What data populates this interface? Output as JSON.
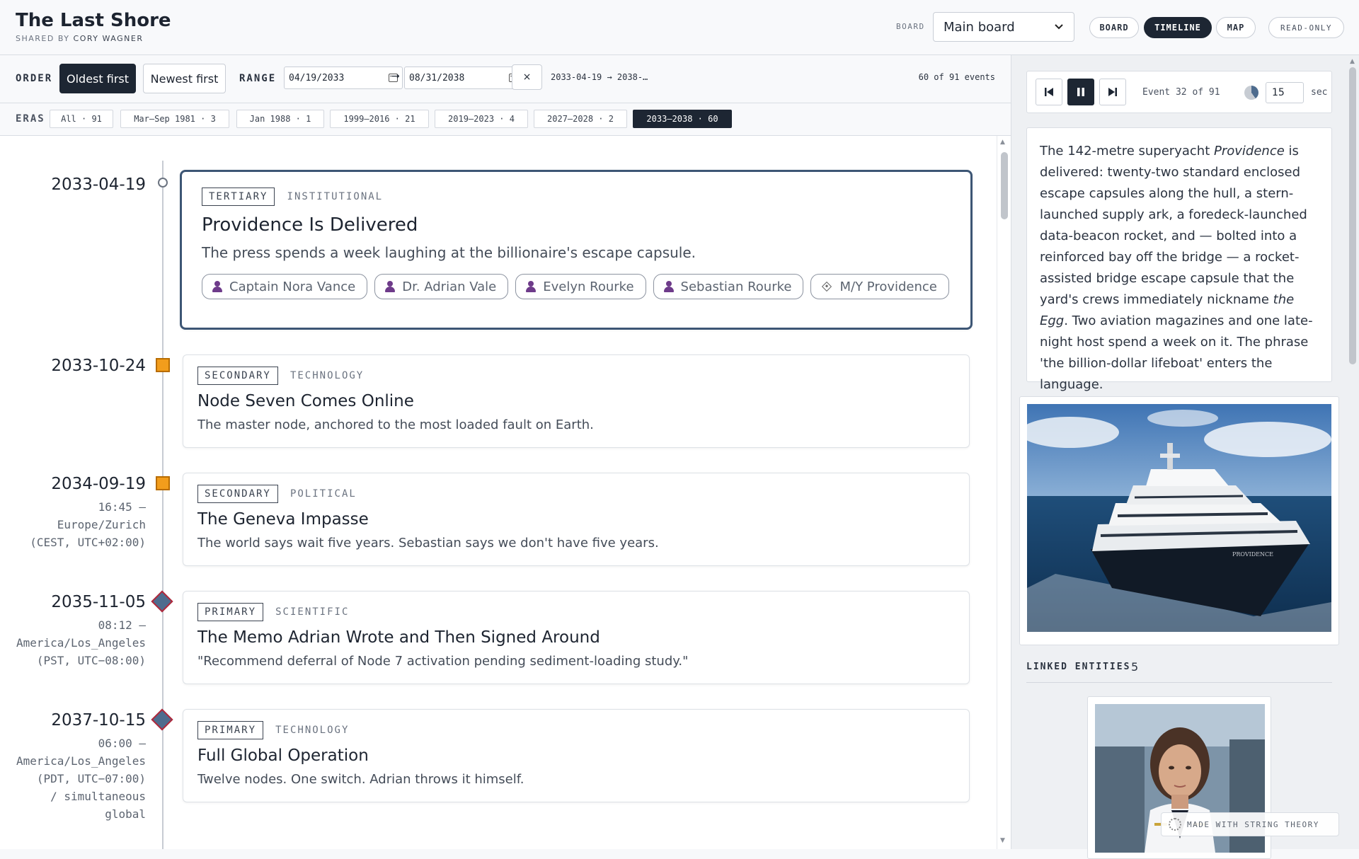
{
  "header": {
    "title": "The Last Shore",
    "shared_by_prefix": "SHARED BY",
    "shared_by_name": "CORY WAGNER",
    "board_label": "BOARD",
    "board_value": "Main board",
    "views": [
      "BOARD",
      "TIMELINE",
      "MAP"
    ],
    "active_view": "TIMELINE",
    "read_only": "READ-ONLY"
  },
  "toolbar": {
    "order_label": "ORDER",
    "oldest_first": "Oldest first",
    "newest_first": "Newest first",
    "range_label": "RANGE",
    "range_start": "04/19/2033",
    "range_end": "08/31/2038",
    "arrow": "→",
    "clear": "×",
    "range_summary": "2033-04-19 → 2038-…",
    "event_count": "60 of 91 events"
  },
  "eras": {
    "label": "ERAS",
    "items": [
      "All · 91",
      "Mar–Sep 1981 · 3",
      "Jan 1988 · 1",
      "1999–2016 · 21",
      "2019–2023 · 4",
      "2027–2028 · 2",
      "2033–2038 · 60"
    ],
    "active_index": 6
  },
  "events": [
    {
      "date": "2033-04-19",
      "time": "",
      "tier": "TERTIARY",
      "category": "INSTITUTIONAL",
      "title": "Providence Is Delivered",
      "desc": "The press spends a week laughing at the billionaire's escape capsule.",
      "chips": [
        "Captain Nora Vance",
        "Dr. Adrian Vale",
        "Evelyn Rourke",
        "Sebastian Rourke",
        "M/Y Providence"
      ]
    },
    {
      "date": "2033-10-24",
      "time": "",
      "tier": "SECONDARY",
      "category": "TECHNOLOGY",
      "title": "Node Seven Comes Online",
      "desc": "The master node, anchored to the most loaded fault on Earth."
    },
    {
      "date": "2034-09-19",
      "time_lines": [
        "16:45 —",
        "Europe/Zurich",
        "(CEST, UTC+02:00)"
      ],
      "tier": "SECONDARY",
      "category": "POLITICAL",
      "title": "The Geneva Impasse",
      "desc": "The world says wait five years. Sebastian says we don't have five years."
    },
    {
      "date": "2035-11-05",
      "time_lines": [
        "08:12 —",
        "America/Los_Angeles",
        "(PST, UTC−08:00)"
      ],
      "tier": "PRIMARY",
      "category": "SCIENTIFIC",
      "title": "The Memo Adrian Wrote and Then Signed Around",
      "desc": "\"Recommend deferral of Node 7 activation pending sediment-loading study.\""
    },
    {
      "date": "2037-10-15",
      "time_lines": [
        "06:00 —",
        "America/Los_Angeles",
        "(PDT, UTC−07:00)",
        "/ simultaneous",
        "global"
      ],
      "tier": "PRIMARY",
      "category": "TECHNOLOGY",
      "title": "Full Global Operation",
      "desc": "Twelve nodes. One switch. Adrian throws it himself."
    }
  ],
  "player": {
    "status": "Event 32 of 91",
    "seconds": "15",
    "sec_label": "sec"
  },
  "detail": {
    "p1": "The 142-metre superyacht ",
    "p1_em": "Providence",
    "p2": " is delivered: twenty-two standard enclosed escape capsules along the hull, a stern-launched supply ark, a foredeck-launched data-beacon rocket, and — bolted into a reinforced bay off the bridge — a rocket-assisted bridge escape capsule that the yard's crews immediately nickname ",
    "p2_em": "the Egg",
    "p3": ". Two aviation magazines and one late-night host spend a week on it. The phrase 'the billion-dollar lifeboat' enters the language.",
    "image_caption": "PROVIDENCE"
  },
  "linked": {
    "label": "LINKED ENTITIES",
    "count": "5"
  },
  "footer": {
    "made_with": "MADE WITH STRING THEORY"
  },
  "colors": {
    "dark": "#1d2633",
    "secondary_marker": "#f29d1c",
    "primary_marker": "#4e6c8e",
    "primary_marker_border": "#b3273a",
    "person_icon": "#6e3b8a",
    "selected_border": "#3d5675"
  }
}
